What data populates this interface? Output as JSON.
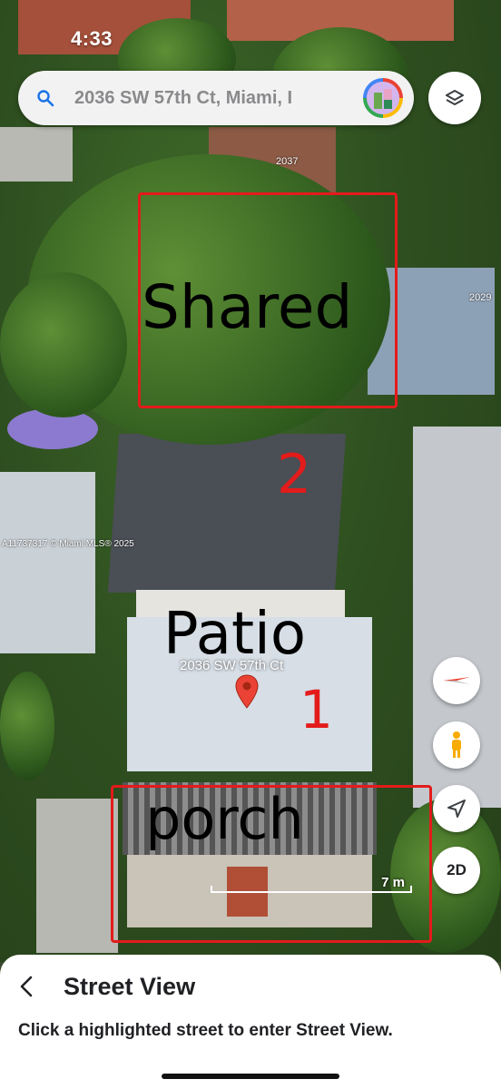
{
  "status_bar": {
    "time": "4:33"
  },
  "search": {
    "value": "2036 SW 57th Ct, Miami, I"
  },
  "map": {
    "house_numbers": [
      "2037",
      "2029"
    ],
    "watermark": "A11737317 © Miami MLS® 2025",
    "address_label": "2036 SW 57th Ct",
    "scale_label": "7 m",
    "annotations": {
      "shared": "Shared",
      "two": "2",
      "patio": "Patio",
      "one": "1",
      "porch": "porch"
    }
  },
  "controls": {
    "mode_2d": "2D"
  },
  "sheet": {
    "title": "Street View",
    "subtitle": "Click a highlighted street to enter Street View."
  },
  "colors": {
    "annotation_red": "#e31b1b",
    "pin_red": "#ea4335",
    "pegman": "#f9ab00"
  }
}
